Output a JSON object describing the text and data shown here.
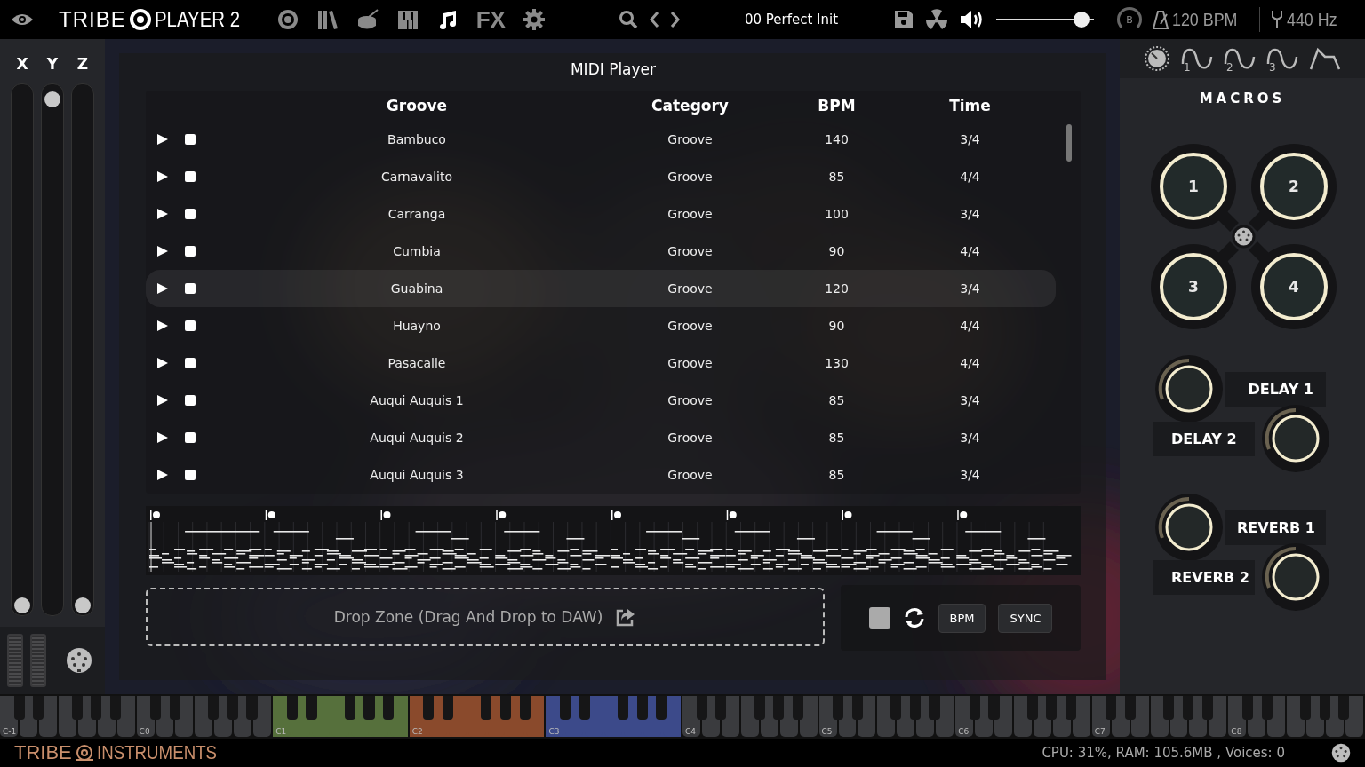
{
  "top_bar": {
    "logo": {
      "brand": "TRIBE",
      "product": "PLAYER 2"
    },
    "tabs": [
      {
        "kind": "target",
        "selected": false
      },
      {
        "kind": "library",
        "selected": false
      },
      {
        "kind": "drum",
        "selected": false
      },
      {
        "kind": "keys",
        "selected": false
      },
      {
        "kind": "note",
        "selected": true
      },
      {
        "kind": "fx",
        "label": "FX",
        "selected": false
      },
      {
        "kind": "gear",
        "selected": false
      }
    ],
    "preset": "00 Perfect Init",
    "volume": {
      "level": 0.95
    },
    "bypass_label": "B",
    "tempo": "120 BPM",
    "tuning": "440 Hz"
  },
  "xyz": [
    {
      "label": "X",
      "level": 0
    },
    {
      "label": "Y",
      "level": 1
    },
    {
      "label": "Z",
      "level": 0
    }
  ],
  "midi_player": {
    "title": "MIDI Player",
    "columns": [
      "Groove",
      "Category",
      "BPM",
      "Time"
    ],
    "rows": [
      {
        "groove": "Bambuco",
        "category": "Groove",
        "bpm": "140",
        "time": "3/4",
        "selected": false
      },
      {
        "groove": "Carnavalito",
        "category": "Groove",
        "bpm": "85",
        "time": "4/4",
        "selected": false
      },
      {
        "groove": "Carranga",
        "category": "Groove",
        "bpm": "100",
        "time": "3/4",
        "selected": false
      },
      {
        "groove": "Cumbia",
        "category": "Groove",
        "bpm": "90",
        "time": "4/4",
        "selected": false
      },
      {
        "groove": "Guabina",
        "category": "Groove",
        "bpm": "120",
        "time": "3/4",
        "selected": true
      },
      {
        "groove": "Huayno",
        "category": "Groove",
        "bpm": "90",
        "time": "4/4",
        "selected": false
      },
      {
        "groove": "Pasacalle",
        "category": "Groove",
        "bpm": "130",
        "time": "4/4",
        "selected": false
      },
      {
        "groove": "Auqui Auquis 1",
        "category": "Groove",
        "bpm": "85",
        "time": "3/4",
        "selected": false
      },
      {
        "groove": "Auqui Auquis 2",
        "category": "Groove",
        "bpm": "85",
        "time": "3/4",
        "selected": false
      },
      {
        "groove": "Auqui Auquis 3",
        "category": "Groove",
        "bpm": "85",
        "time": "3/4",
        "selected": false
      }
    ],
    "drop_zone": "Drop Zone (Drag And Drop to DAW)",
    "buttons": [
      "BPM",
      "SYNC"
    ]
  },
  "right_panel": {
    "tabs": [
      {
        "kind": "knob"
      },
      {
        "kind": "lfo",
        "label": "1"
      },
      {
        "kind": "lfo",
        "label": "2"
      },
      {
        "kind": "lfo",
        "label": "3"
      },
      {
        "kind": "envelope"
      }
    ],
    "macros_title": "MACROS",
    "macros": [
      "1",
      "2",
      "3",
      "4"
    ],
    "effects": [
      "DELAY 1",
      "DELAY 2",
      "REVERB 1",
      "REVERB 2"
    ]
  },
  "keyboard": {
    "octaves": [
      {
        "label": "C-1"
      },
      {
        "label": "C0"
      },
      {
        "label": "C1",
        "color": "#56703c"
      },
      {
        "label": "C2",
        "color": "#8a4a2c"
      },
      {
        "label": "C3",
        "color": "#3c4a8a"
      },
      {
        "label": "C4"
      },
      {
        "label": "C5"
      },
      {
        "label": "C6"
      },
      {
        "label": "C7"
      },
      {
        "label": "C8"
      }
    ]
  },
  "footer": {
    "logo": {
      "brand": "TRIBE",
      "product": "INSTRUMENTS"
    },
    "status": "CPU: 31%, RAM: 105.6MB , Voices: 0"
  }
}
